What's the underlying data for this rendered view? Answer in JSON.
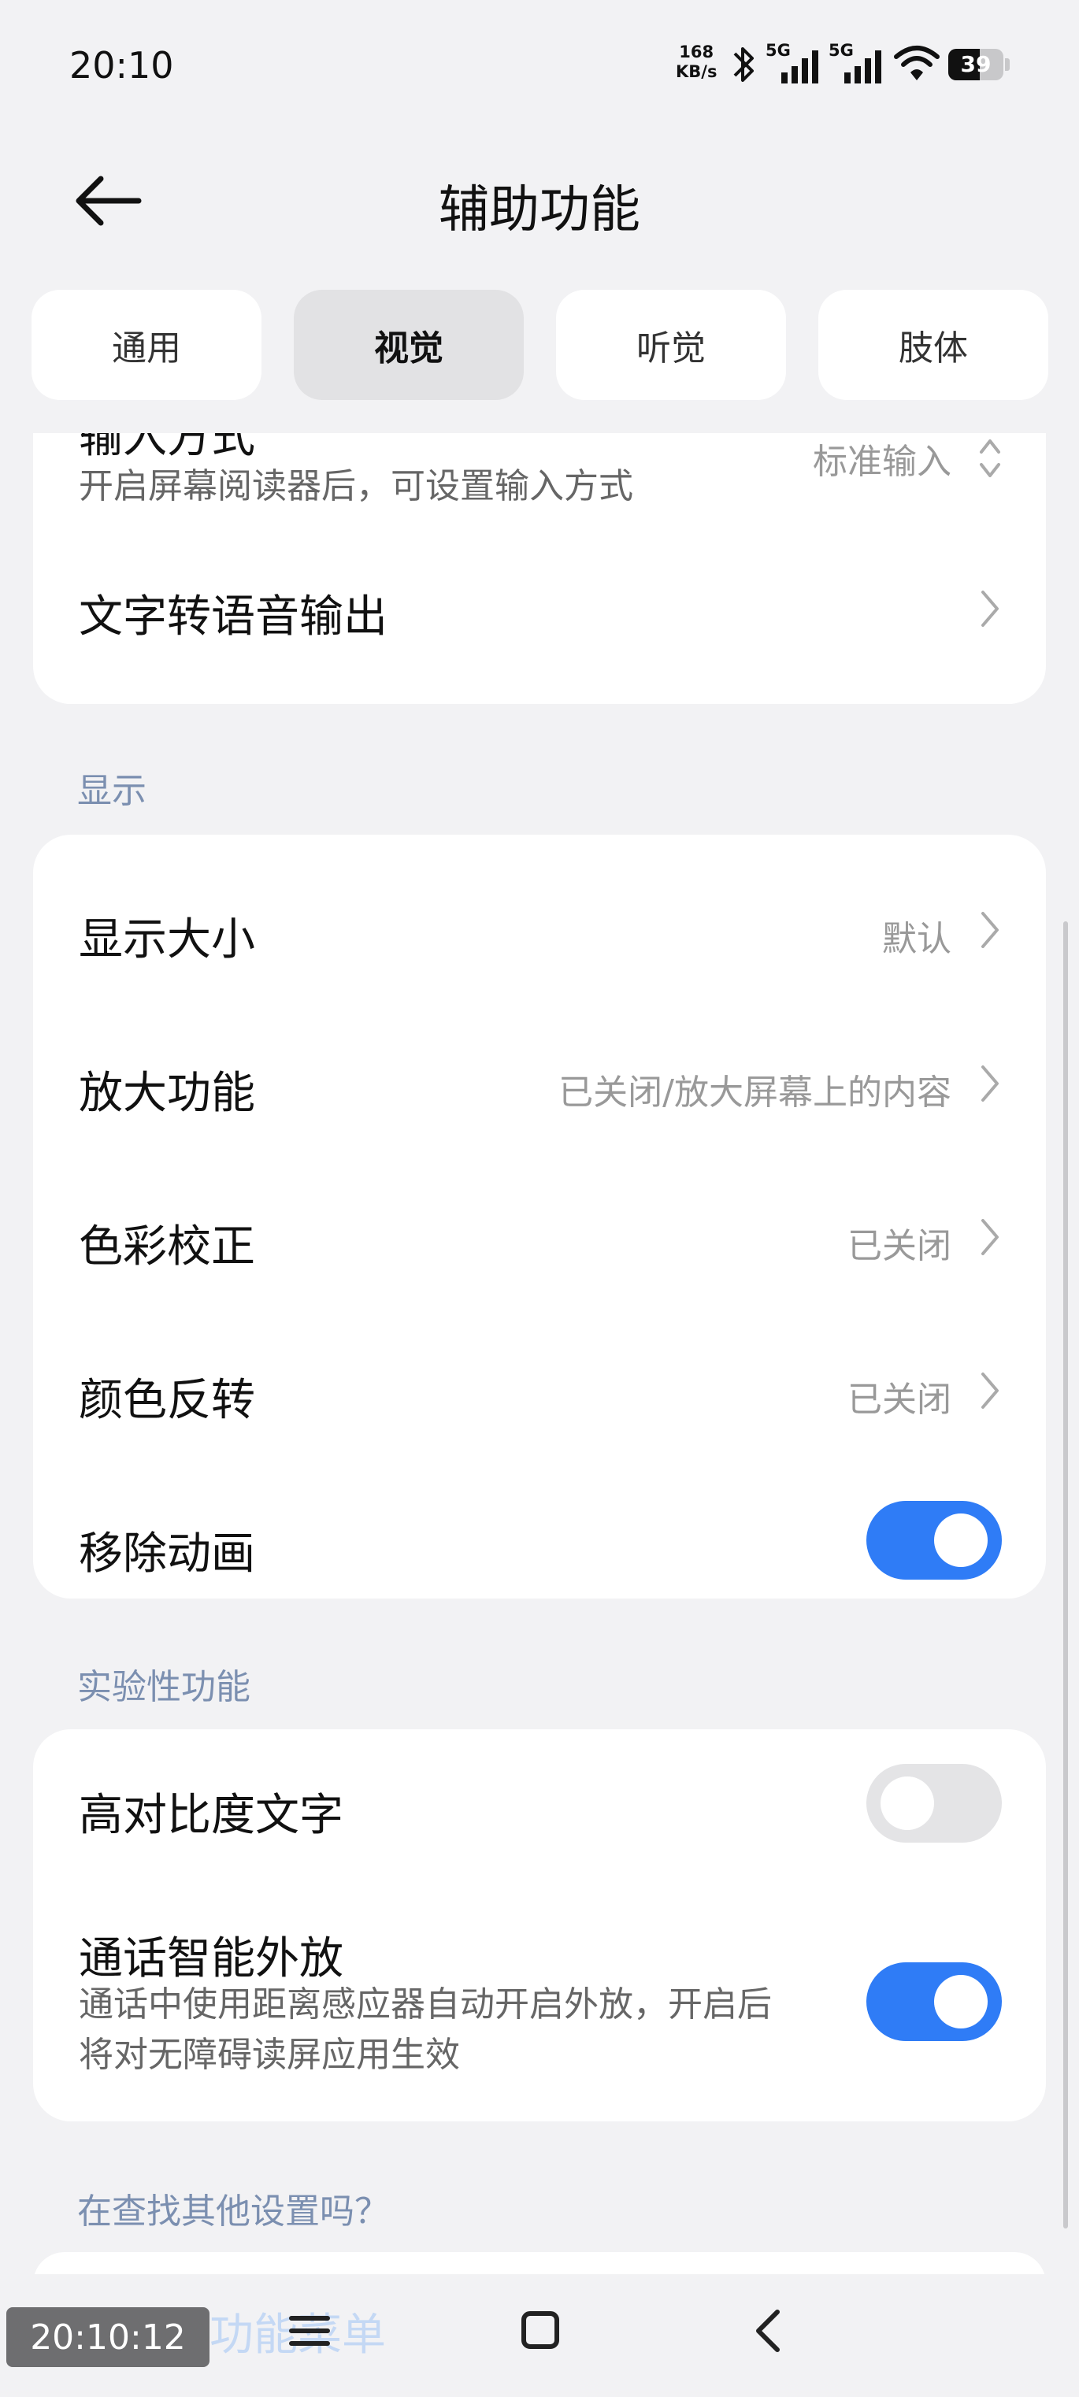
{
  "status_bar": {
    "time": "20:10",
    "net_speed_value": "168",
    "net_speed_unit": "KB/s",
    "signal_1_label": "5G",
    "signal_2_label": "5G",
    "battery": "39"
  },
  "header": {
    "title": "辅助功能"
  },
  "tabs": [
    {
      "label": "通用",
      "active": false
    },
    {
      "label": "视觉",
      "active": true
    },
    {
      "label": "听觉",
      "active": false
    },
    {
      "label": "肢体",
      "active": false
    }
  ],
  "top_card": {
    "input_method": {
      "label": "输入方式",
      "subtitle": "开启屏幕阅读器后，可设置输入方式",
      "value": "标准输入"
    },
    "tts": {
      "label": "文字转语音输出"
    }
  },
  "display_section": {
    "title": "显示",
    "items": [
      {
        "label": "显示大小",
        "value": "默认"
      },
      {
        "label": "放大功能",
        "value": "已关闭/放大屏幕上的内容"
      },
      {
        "label": "色彩校正",
        "value": "已关闭"
      },
      {
        "label": "颜色反转",
        "value": "已关闭"
      }
    ],
    "remove_animation": {
      "label": "移除动画",
      "enabled": true
    }
  },
  "experimental_section": {
    "title": "实验性功能",
    "high_contrast": {
      "label": "高对比度文字",
      "enabled": false
    },
    "smart_speaker": {
      "label": "通话智能外放",
      "subtitle_line1": "通话中使用距离感应器自动开启外放，开启后",
      "subtitle_line2": "将对无障碍读屏应用生效",
      "enabled": true
    }
  },
  "other_section": {
    "title": "在查找其他设置吗？",
    "link": "无障碍功能菜单"
  },
  "overlay": {
    "clock": "20:10:12"
  },
  "colors": {
    "accent": "#2f7cf6",
    "section_title": "#7b8fb0",
    "background": "#f2f2f4"
  }
}
